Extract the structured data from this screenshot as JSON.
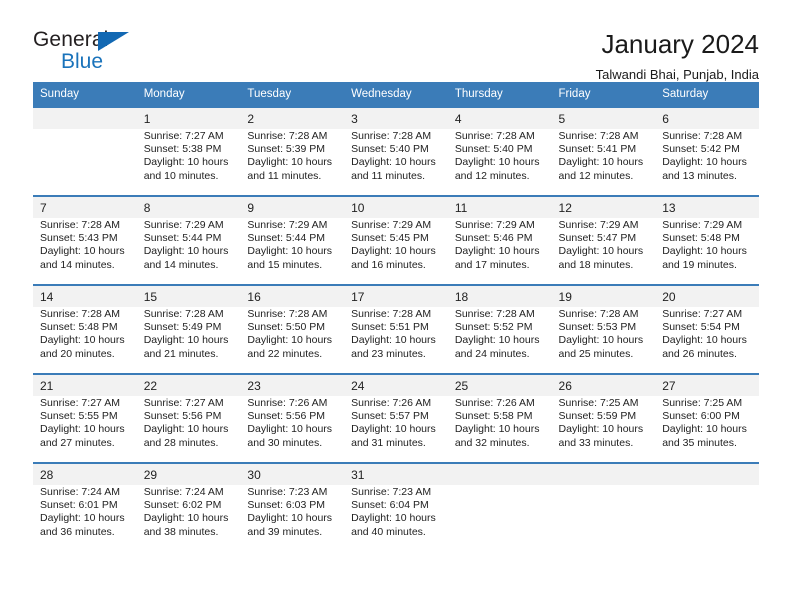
{
  "logo": {
    "word1": "General",
    "word2": "Blue",
    "triangle_color": "#1268b3",
    "blue_color": "#1a73bb"
  },
  "header": {
    "title": "January 2024",
    "location": "Talwandi Bhai, Punjab, India"
  },
  "theme": {
    "header_blue": "#3b7cb8",
    "daynum_bg": "#f2f2f2",
    "text": "#222222"
  },
  "weekdays": [
    "Sunday",
    "Monday",
    "Tuesday",
    "Wednesday",
    "Thursday",
    "Friday",
    "Saturday"
  ],
  "labels": {
    "sunrise": "Sunrise:",
    "sunset": "Sunset:",
    "daylight": "Daylight:"
  },
  "weeks": [
    [
      {
        "day": "",
        "line1": "",
        "line2": "",
        "line3": "",
        "line4": ""
      },
      {
        "day": "1",
        "line1": "Sunrise: 7:27 AM",
        "line2": "Sunset: 5:38 PM",
        "line3": "Daylight: 10 hours",
        "line4": "and 10 minutes."
      },
      {
        "day": "2",
        "line1": "Sunrise: 7:28 AM",
        "line2": "Sunset: 5:39 PM",
        "line3": "Daylight: 10 hours",
        "line4": "and 11 minutes."
      },
      {
        "day": "3",
        "line1": "Sunrise: 7:28 AM",
        "line2": "Sunset: 5:40 PM",
        "line3": "Daylight: 10 hours",
        "line4": "and 11 minutes."
      },
      {
        "day": "4",
        "line1": "Sunrise: 7:28 AM",
        "line2": "Sunset: 5:40 PM",
        "line3": "Daylight: 10 hours",
        "line4": "and 12 minutes."
      },
      {
        "day": "5",
        "line1": "Sunrise: 7:28 AM",
        "line2": "Sunset: 5:41 PM",
        "line3": "Daylight: 10 hours",
        "line4": "and 12 minutes."
      },
      {
        "day": "6",
        "line1": "Sunrise: 7:28 AM",
        "line2": "Sunset: 5:42 PM",
        "line3": "Daylight: 10 hours",
        "line4": "and 13 minutes."
      }
    ],
    [
      {
        "day": "7",
        "line1": "Sunrise: 7:28 AM",
        "line2": "Sunset: 5:43 PM",
        "line3": "Daylight: 10 hours",
        "line4": "and 14 minutes."
      },
      {
        "day": "8",
        "line1": "Sunrise: 7:29 AM",
        "line2": "Sunset: 5:44 PM",
        "line3": "Daylight: 10 hours",
        "line4": "and 14 minutes."
      },
      {
        "day": "9",
        "line1": "Sunrise: 7:29 AM",
        "line2": "Sunset: 5:44 PM",
        "line3": "Daylight: 10 hours",
        "line4": "and 15 minutes."
      },
      {
        "day": "10",
        "line1": "Sunrise: 7:29 AM",
        "line2": "Sunset: 5:45 PM",
        "line3": "Daylight: 10 hours",
        "line4": "and 16 minutes."
      },
      {
        "day": "11",
        "line1": "Sunrise: 7:29 AM",
        "line2": "Sunset: 5:46 PM",
        "line3": "Daylight: 10 hours",
        "line4": "and 17 minutes."
      },
      {
        "day": "12",
        "line1": "Sunrise: 7:29 AM",
        "line2": "Sunset: 5:47 PM",
        "line3": "Daylight: 10 hours",
        "line4": "and 18 minutes."
      },
      {
        "day": "13",
        "line1": "Sunrise: 7:29 AM",
        "line2": "Sunset: 5:48 PM",
        "line3": "Daylight: 10 hours",
        "line4": "and 19 minutes."
      }
    ],
    [
      {
        "day": "14",
        "line1": "Sunrise: 7:28 AM",
        "line2": "Sunset: 5:48 PM",
        "line3": "Daylight: 10 hours",
        "line4": "and 20 minutes."
      },
      {
        "day": "15",
        "line1": "Sunrise: 7:28 AM",
        "line2": "Sunset: 5:49 PM",
        "line3": "Daylight: 10 hours",
        "line4": "and 21 minutes."
      },
      {
        "day": "16",
        "line1": "Sunrise: 7:28 AM",
        "line2": "Sunset: 5:50 PM",
        "line3": "Daylight: 10 hours",
        "line4": "and 22 minutes."
      },
      {
        "day": "17",
        "line1": "Sunrise: 7:28 AM",
        "line2": "Sunset: 5:51 PM",
        "line3": "Daylight: 10 hours",
        "line4": "and 23 minutes."
      },
      {
        "day": "18",
        "line1": "Sunrise: 7:28 AM",
        "line2": "Sunset: 5:52 PM",
        "line3": "Daylight: 10 hours",
        "line4": "and 24 minutes."
      },
      {
        "day": "19",
        "line1": "Sunrise: 7:28 AM",
        "line2": "Sunset: 5:53 PM",
        "line3": "Daylight: 10 hours",
        "line4": "and 25 minutes."
      },
      {
        "day": "20",
        "line1": "Sunrise: 7:27 AM",
        "line2": "Sunset: 5:54 PM",
        "line3": "Daylight: 10 hours",
        "line4": "and 26 minutes."
      }
    ],
    [
      {
        "day": "21",
        "line1": "Sunrise: 7:27 AM",
        "line2": "Sunset: 5:55 PM",
        "line3": "Daylight: 10 hours",
        "line4": "and 27 minutes."
      },
      {
        "day": "22",
        "line1": "Sunrise: 7:27 AM",
        "line2": "Sunset: 5:56 PM",
        "line3": "Daylight: 10 hours",
        "line4": "and 28 minutes."
      },
      {
        "day": "23",
        "line1": "Sunrise: 7:26 AM",
        "line2": "Sunset: 5:56 PM",
        "line3": "Daylight: 10 hours",
        "line4": "and 30 minutes."
      },
      {
        "day": "24",
        "line1": "Sunrise: 7:26 AM",
        "line2": "Sunset: 5:57 PM",
        "line3": "Daylight: 10 hours",
        "line4": "and 31 minutes."
      },
      {
        "day": "25",
        "line1": "Sunrise: 7:26 AM",
        "line2": "Sunset: 5:58 PM",
        "line3": "Daylight: 10 hours",
        "line4": "and 32 minutes."
      },
      {
        "day": "26",
        "line1": "Sunrise: 7:25 AM",
        "line2": "Sunset: 5:59 PM",
        "line3": "Daylight: 10 hours",
        "line4": "and 33 minutes."
      },
      {
        "day": "27",
        "line1": "Sunrise: 7:25 AM",
        "line2": "Sunset: 6:00 PM",
        "line3": "Daylight: 10 hours",
        "line4": "and 35 minutes."
      }
    ],
    [
      {
        "day": "28",
        "line1": "Sunrise: 7:24 AM",
        "line2": "Sunset: 6:01 PM",
        "line3": "Daylight: 10 hours",
        "line4": "and 36 minutes."
      },
      {
        "day": "29",
        "line1": "Sunrise: 7:24 AM",
        "line2": "Sunset: 6:02 PM",
        "line3": "Daylight: 10 hours",
        "line4": "and 38 minutes."
      },
      {
        "day": "30",
        "line1": "Sunrise: 7:23 AM",
        "line2": "Sunset: 6:03 PM",
        "line3": "Daylight: 10 hours",
        "line4": "and 39 minutes."
      },
      {
        "day": "31",
        "line1": "Sunrise: 7:23 AM",
        "line2": "Sunset: 6:04 PM",
        "line3": "Daylight: 10 hours",
        "line4": "and 40 minutes."
      },
      {
        "day": "",
        "line1": "",
        "line2": "",
        "line3": "",
        "line4": ""
      },
      {
        "day": "",
        "line1": "",
        "line2": "",
        "line3": "",
        "line4": ""
      },
      {
        "day": "",
        "line1": "",
        "line2": "",
        "line3": "",
        "line4": ""
      }
    ]
  ]
}
